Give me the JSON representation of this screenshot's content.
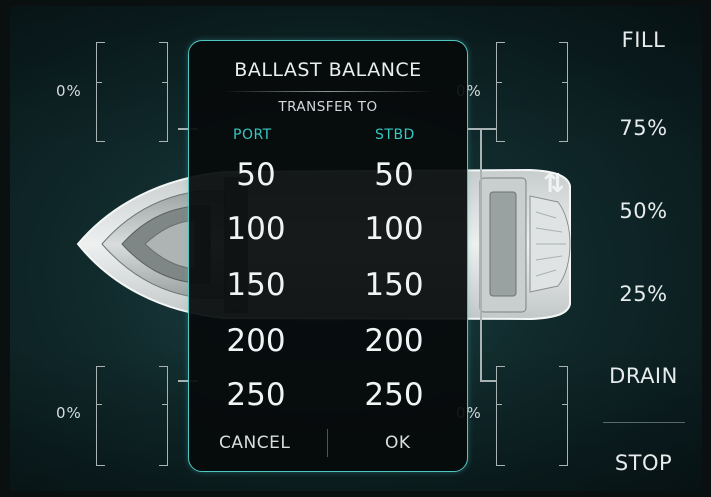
{
  "tanks": {
    "port_front": "0%",
    "stbd_front": "0%",
    "port_rear": "0%",
    "stbd_rear": "0%"
  },
  "dialog": {
    "title": "BALLAST BALANCE",
    "subtitle": "TRANSFER TO",
    "port_label": "PORT",
    "stbd_label": "STBD",
    "port_values": [
      "50",
      "100",
      "150",
      "200",
      "250"
    ],
    "stbd_values": [
      "50",
      "100",
      "150",
      "200",
      "250"
    ],
    "cancel_label": "CANCEL",
    "ok_label": "OK"
  },
  "right_panel": {
    "fill": "FILL",
    "p75": "75%",
    "p50": "50%",
    "p25": "25%",
    "drain": "DRAIN",
    "stop": "STOP"
  },
  "icons": {
    "transfer": "transfer-arrows-icon",
    "glyph": "⇅"
  },
  "colors": {
    "accent": "#4fc7c4",
    "column_heading": "#39c7c1",
    "background": "#10292b"
  }
}
